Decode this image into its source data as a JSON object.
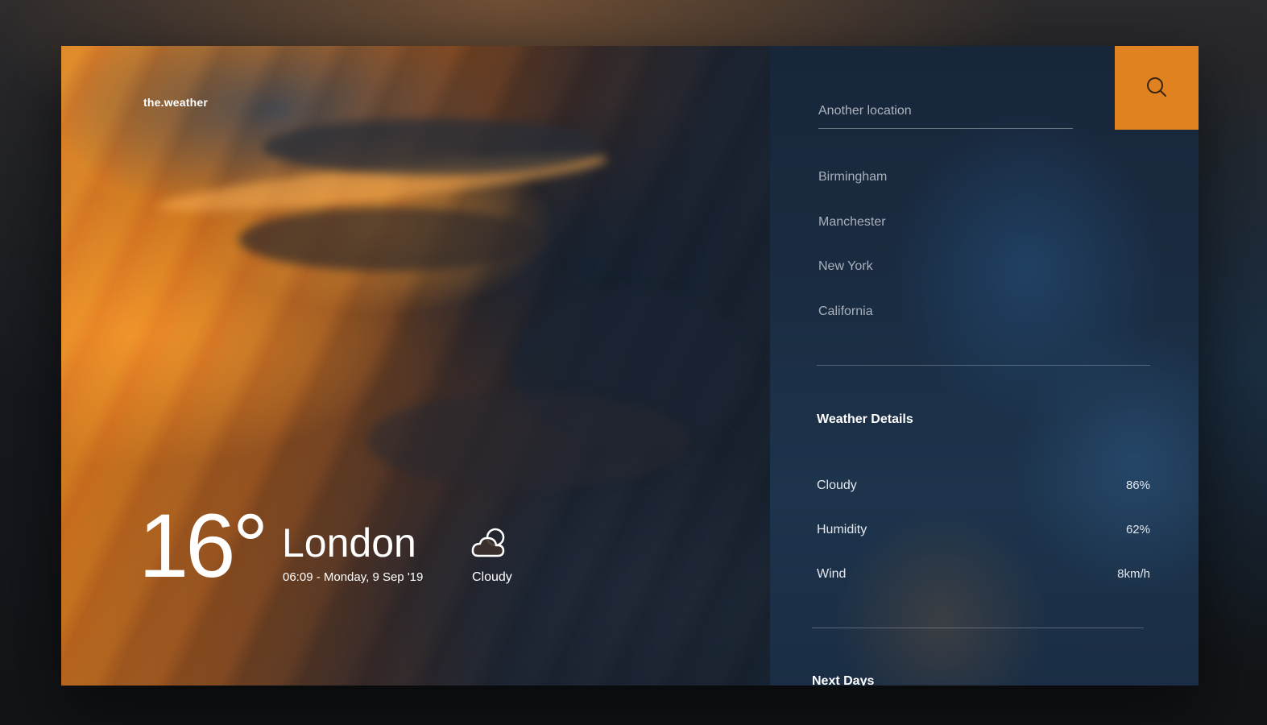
{
  "brand": "the.weather",
  "current": {
    "temperature": "16°",
    "city": "London",
    "datetime": "06:09 - Monday, 9 Sep '19",
    "condition": "Cloudy",
    "condition_icon": "cloud-sun-icon"
  },
  "search": {
    "placeholder": "Another location",
    "button_icon": "search-icon"
  },
  "locations": [
    "Birmingham",
    "Manchester",
    "New York",
    "California"
  ],
  "details": {
    "title": "Weather Details",
    "rows": [
      {
        "label": "Cloudy",
        "value": "86%"
      },
      {
        "label": "Humidity",
        "value": "62%"
      },
      {
        "label": "Wind",
        "value": "8km/h"
      }
    ]
  },
  "next_days": {
    "title": "Next Days"
  },
  "colors": {
    "accent": "#e0821f"
  }
}
